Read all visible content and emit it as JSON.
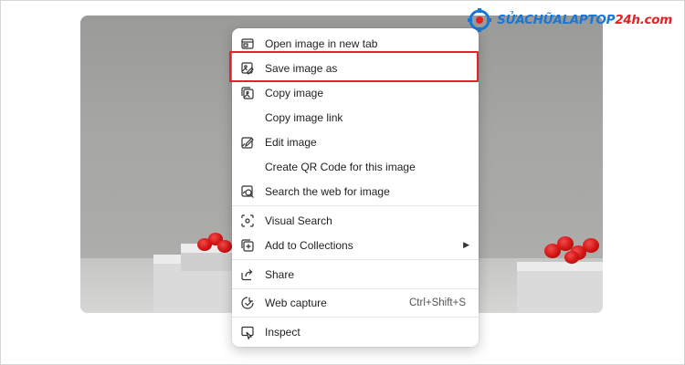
{
  "brand": {
    "name_main": "SỬACHỮALAPTOP",
    "name_accent": "24h.com"
  },
  "menu": {
    "items": [
      {
        "label": "Open image in new tab",
        "icon": "open-new-tab-icon"
      },
      {
        "label": "Save image as",
        "icon": "save-image-icon",
        "highlighted": true
      },
      {
        "label": "Copy image",
        "icon": "copy-image-icon"
      },
      {
        "label": "Copy image link",
        "icon": ""
      },
      {
        "label": "Edit image",
        "icon": "edit-image-icon"
      },
      {
        "label": "Create QR Code for this image",
        "icon": ""
      },
      {
        "label": "Search the web for image",
        "icon": "search-web-image-icon"
      },
      {
        "label": "Visual Search",
        "icon": "visual-search-icon"
      },
      {
        "label": "Add to Collections",
        "icon": "add-collections-icon",
        "submenu": true
      },
      {
        "label": "Share",
        "icon": "share-icon"
      },
      {
        "label": "Web capture",
        "icon": "web-capture-icon",
        "shortcut": "Ctrl+Shift+S"
      },
      {
        "label": "Inspect",
        "icon": "inspect-icon"
      }
    ]
  },
  "colors": {
    "highlight": "#e2242a",
    "brand_blue": "#1b77d4",
    "brand_red": "#e52026"
  }
}
